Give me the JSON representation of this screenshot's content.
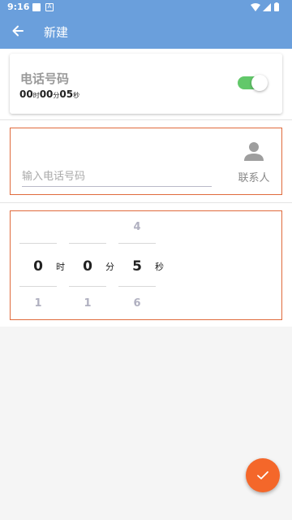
{
  "status_bar": {
    "time": "9:16",
    "notif_b": "A"
  },
  "app_bar": {
    "title": "新建"
  },
  "card": {
    "label": "电话号码",
    "toggle_on": true,
    "duration": {
      "hours": "00",
      "hours_unit": "时",
      "minutes": "00",
      "minutes_unit": "分",
      "seconds": "05",
      "seconds_unit": "秒"
    }
  },
  "phone": {
    "placeholder": "输入电话号码",
    "value": "",
    "contact_label": "联系人"
  },
  "picker": {
    "hours": {
      "prev": "",
      "current": "0",
      "next": "1",
      "unit": "时"
    },
    "minutes": {
      "prev": "",
      "current": "0",
      "next": "1",
      "unit": "分"
    },
    "seconds": {
      "prev": "4",
      "current": "5",
      "next": "6",
      "unit": "秒"
    }
  },
  "fab": {
    "icon": "check-icon"
  },
  "colors": {
    "primary": "#6a9fdc",
    "accent": "#f4672a",
    "toggle": "#62c86a",
    "box_border": "#e06a3c"
  }
}
